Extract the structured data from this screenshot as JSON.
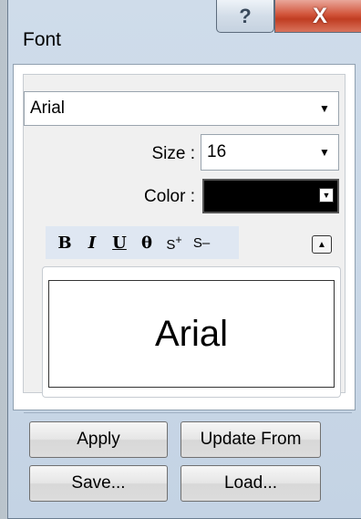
{
  "window": {
    "title": "Font",
    "help_glyph": "?",
    "close_glyph": "X"
  },
  "font": {
    "family": "Arial",
    "size_label": "Size :",
    "size": "16",
    "color_label": "Color :",
    "color_value": "#000000"
  },
  "format_toolbar": {
    "bold": "B",
    "italic": "I",
    "underline": "U",
    "strike": "O",
    "superscript": "S+",
    "subscript": "S–"
  },
  "preview": {
    "text": "Arial"
  },
  "buttons": {
    "apply": "Apply",
    "update_from": "Update From",
    "save": "Save...",
    "load": "Load..."
  },
  "icons": {
    "dropdown": "chevron-down-icon",
    "collapse": "eject-icon"
  }
}
